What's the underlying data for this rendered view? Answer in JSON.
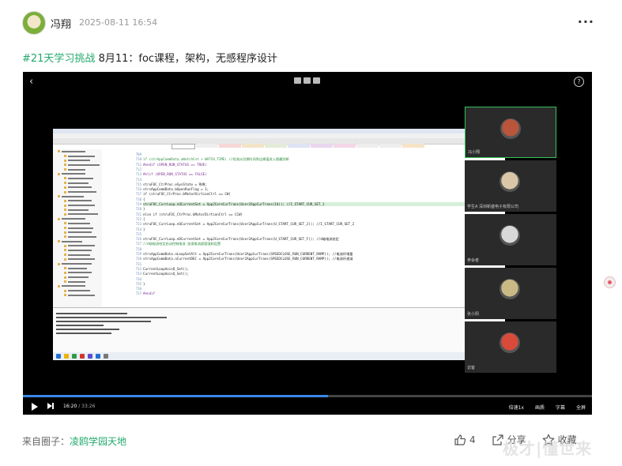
{
  "post": {
    "username": "冯翔",
    "timestamp": "2025-08-11 16:54",
    "more_label": "···",
    "hashtag": "#21天学习挑战",
    "title_text": " 8月11：foc课程，架构，无感程序设计"
  },
  "video": {
    "current_time": "16:20",
    "duration": "/ 33:26",
    "controls_right": [
      "倍速1x",
      "画质",
      "字幕",
      "全屏"
    ],
    "participants": [
      {
        "name": "冯小翔",
        "face_color": "#b8553b"
      },
      {
        "name": "学生A 深圳新盛电子有限公司",
        "face_color": "#d9c7a8"
      },
      {
        "name": "参会者",
        "face_color": "#d8d8d8"
      },
      {
        "name": "张小阳",
        "face_color": "#c9b985"
      },
      {
        "name": "访客",
        "face_color": "#d84a3a"
      }
    ],
    "code_lines": [
      {
        "no": "709",
        "text": "",
        "cls": ""
      },
      {
        "no": "710",
        "text": "        if (strAppCommData.uWatchCnt > WATCH_TIME)   //检测从切换时间到达阈值进入隐藏判断",
        "cls": "cm"
      },
      {
        "no": "711",
        "text": "#endif  (OPEN_RUN_STATUS == TRUE)",
        "cls": "kw"
      },
      {
        "no": "712",
        "text": "",
        "cls": ""
      },
      {
        "no": "713",
        "text": "#elif (OPEN_RUN_STATUS == FALSE)",
        "cls": "kw"
      },
      {
        "no": "714",
        "text": "",
        "cls": ""
      },
      {
        "no": "715",
        "text": "        struFOC_CtrProc.eSysState = RUN;",
        "cls": ""
      },
      {
        "no": "716",
        "text": "        strsAppCommData.bOpenRunFlag = 1;",
        "cls": ""
      },
      {
        "no": "717",
        "text": "        if (struFOC_CtrProc.bMotorDirtionCtrl == CW)",
        "cls": ""
      },
      {
        "no": "718",
        "text": "        {",
        "cls": ""
      },
      {
        "no": "719",
        "text": "            struFOC_CurrLoop.nQCurrentSet = App2CoreCurTrans(User2AppCurTrans(Id)); //I_START_CUR_SET_1",
        "cls": "hl"
      },
      {
        "no": "720",
        "text": "        }",
        "cls": ""
      },
      {
        "no": "721",
        "text": "        else if (struFOC_CtrProc.bMotorDirtionCtrl == CCW)",
        "cls": ""
      },
      {
        "no": "722",
        "text": "        {",
        "cls": ""
      },
      {
        "no": "723",
        "text": "            struFOC_CurrLoop.nQCurrentSet = App2CoreCurTrans(User2AppCurTrans(U_START_CUR_SET_2)); //I_START_CUR_SET_2",
        "cls": ""
      },
      {
        "no": "724",
        "text": "        }",
        "cls": ""
      },
      {
        "no": "725",
        "text": "",
        "cls": ""
      },
      {
        "no": "726",
        "text": "        struFOC_CurrLoop.nDCurrentSet = App2CoreCurTrans(User2AppCurTrans(U_START_CUR_SET_F)); //d轴电流给定",
        "cls": ""
      },
      {
        "no": "727",
        "text": "        //d轴电流给定启动控制电流 加速电流超值强制设置",
        "cls": "cm"
      },
      {
        "no": "728",
        "text": "",
        "cls": ""
      },
      {
        "no": "729",
        "text": "        strsAppCommData.nLoopSetAlt = App2CoreCurTrans(User2AppCurTrans(SPEEDCLOSE_RUN_CURRENT_RAMP)); //电流环增量",
        "cls": ""
      },
      {
        "no": "730",
        "text": "        strsAppCommData.nCurrentDEC = App2CoreCurTrans(User2AppCurTrans(SPEEDCLOSE_RUN_CURRENT_RAMP)); //电流环递减",
        "cls": ""
      },
      {
        "no": "731",
        "text": "",
        "cls": ""
      },
      {
        "no": "732",
        "text": "        CurrentLoopAxisD_Set();",
        "cls": ""
      },
      {
        "no": "733",
        "text": "        CurrentLoopAxisQ_Set();",
        "cls": ""
      },
      {
        "no": "734",
        "text": "",
        "cls": ""
      },
      {
        "no": "735",
        "text": "    }",
        "cls": ""
      },
      {
        "no": "736",
        "text": "",
        "cls": ""
      },
      {
        "no": "737",
        "text": "#endif",
        "cls": "kw"
      }
    ]
  },
  "footer": {
    "source_prefix": "来自圈子：",
    "circle_name": "凌鸥学园天地",
    "like_count": "4",
    "share_label": "分享",
    "collect_label": "收藏",
    "watermark": "极才 | 懂世来"
  },
  "colors": {
    "accent_green": "#23a96b",
    "progress_blue": "#3a88e8"
  }
}
